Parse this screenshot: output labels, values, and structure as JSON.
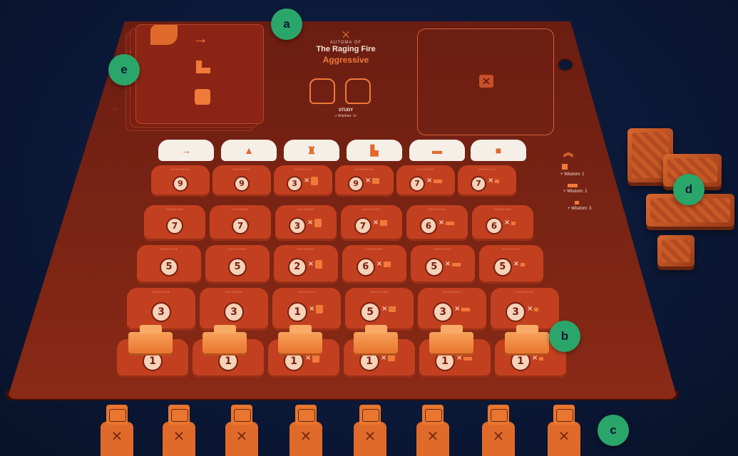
{
  "board": {
    "title_small": "AUTOMA OF",
    "title": "The Raging Fire",
    "mode": "Aggressive",
    "study_label": "STUDY",
    "study_text": "+ Wisdom: 1+",
    "slot_icon": "✕"
  },
  "deck": {
    "glyphs": [
      "→",
      "L-shape",
      "person"
    ]
  },
  "side_marks": [
    "› ›",
    "› ›"
  ],
  "column_headers": [
    {
      "icon": "arrow-right-icon",
      "glyph": "→"
    },
    {
      "icon": "mountain-icon",
      "glyph": "▲"
    },
    {
      "icon": "person-icon",
      "glyph": "♜"
    },
    {
      "icon": "l-shape-icon",
      "glyph": "▙"
    },
    {
      "icon": "bar-icon",
      "glyph": "▬"
    },
    {
      "icon": "small-square-icon",
      "glyph": "■"
    }
  ],
  "grid": [
    [
      "9",
      "9",
      "3",
      "9",
      "7",
      "7"
    ],
    [
      "7",
      "7",
      "3",
      "7",
      "6",
      "6"
    ],
    [
      "5",
      "5",
      "2",
      "6",
      "5",
      "5"
    ],
    [
      "3",
      "3",
      "1",
      "5",
      "3",
      "3"
    ],
    [
      "1",
      "1",
      "1",
      "1",
      "1",
      "1"
    ]
  ],
  "multiplier": "×",
  "legend": [
    {
      "shape": "l-shape",
      "text": "+ Wisdom: 1"
    },
    {
      "shape": "bar",
      "text": "+ Wisdom: 2"
    },
    {
      "shape": "square",
      "text": "+ Wisdom: 3"
    }
  ],
  "callouts": [
    "a",
    "b",
    "c",
    "d",
    "e"
  ],
  "colors": {
    "board": "#7a2414",
    "tile": "#c2401f",
    "accent": "#f07a3a",
    "callout": "#2aa66a",
    "background": "#0b1836"
  }
}
